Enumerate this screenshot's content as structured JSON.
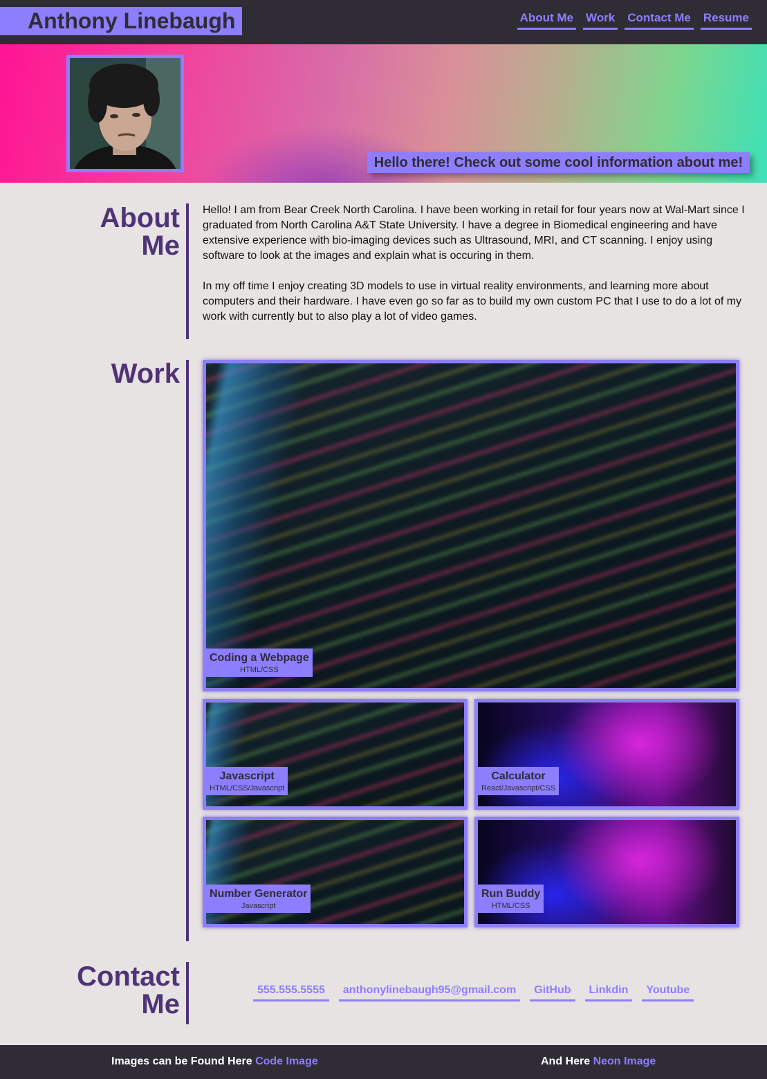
{
  "header": {
    "site_title": "Anthony Linebaugh",
    "nav": [
      "About Me",
      "Work",
      "Contact Me",
      "Resume"
    ]
  },
  "hero": {
    "tagline": "Hello there! Check out some cool information about me!"
  },
  "about": {
    "title_line1": "About",
    "title_line2": "Me",
    "paragraph1": "Hello! I am from Bear Creek North Carolina. I have been working in retail for four years now at Wal-Mart since I graduated from North Carolina A&T State University. I have a degree in Biomedical engineering and have extensive experience with bio-imaging devices such as Ultrasound, MRI, and CT scanning. I enjoy using software to look at the images and explain what is occuring in them.",
    "paragraph2": "In my off time I enjoy creating 3D models to use in virtual reality environments, and learning more about computers and their hardware. I have even go so far as to build my own custom PC that I use to do a lot of my work with currently but to also play a lot of video games."
  },
  "work": {
    "title": "Work",
    "projects": [
      {
        "title": "Coding a Webpage",
        "tech": "HTML/CSS"
      },
      {
        "title": "Javascript",
        "tech": "HTML/CSS/Javascript"
      },
      {
        "title": "Calculator",
        "tech": "React/Javascript/CSS"
      },
      {
        "title": "Number Generator",
        "tech": "Javascript"
      },
      {
        "title": "Run Buddy",
        "tech": "HTML/CSS"
      }
    ]
  },
  "contact": {
    "title_line1": "Contact",
    "title_line2": "Me",
    "links": [
      "555.555.5555",
      "anthonylinebaugh95@gmail.com",
      "GitHub",
      "Linkdin",
      "Youtube"
    ]
  },
  "footer": {
    "left_text": "Images can be Found Here ",
    "left_link": "Code Image",
    "right_text": "And Here ",
    "right_link": "Neon Image"
  }
}
